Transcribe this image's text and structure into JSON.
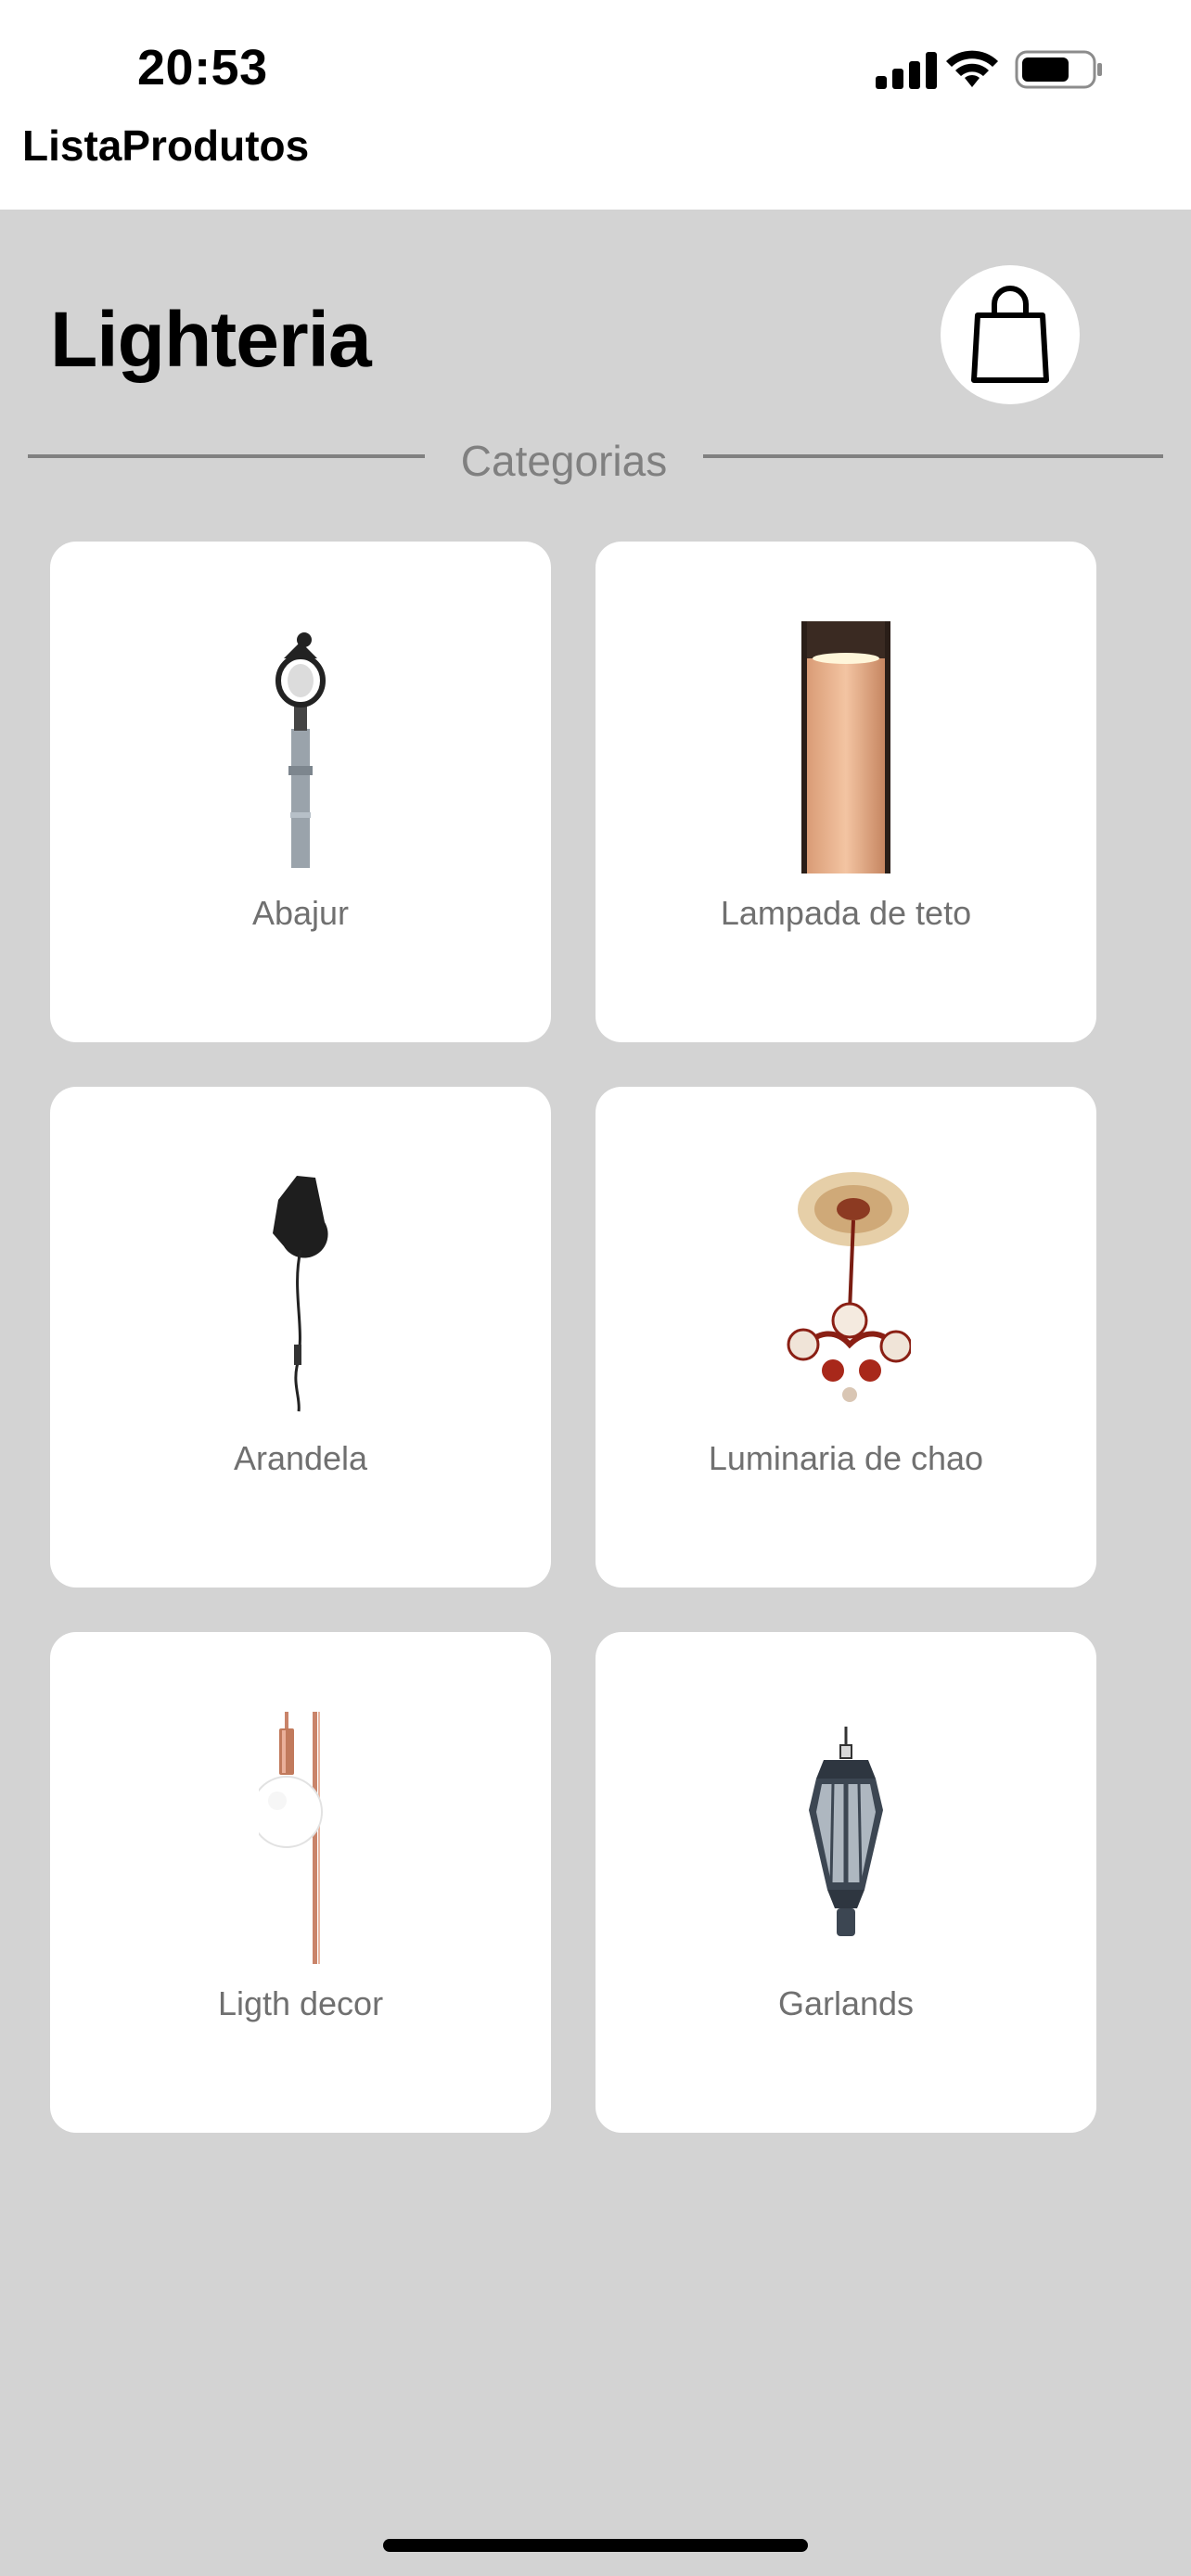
{
  "status_bar": {
    "time": "20:53",
    "icons": [
      "cellular-signal-icon",
      "wifi-icon",
      "battery-icon"
    ]
  },
  "nav": {
    "title": "ListaProdutos"
  },
  "header": {
    "brand": "Lighteria",
    "cart_icon": "shopping-bag-icon"
  },
  "section": {
    "title": "Categorias"
  },
  "categories": [
    {
      "label": "Abajur",
      "icon": "street-lamp-icon"
    },
    {
      "label": "Lampada de teto",
      "icon": "ceiling-lamp-icon"
    },
    {
      "label": "Arandela",
      "icon": "wall-sconce-icon"
    },
    {
      "label": "Luminaria de chao",
      "icon": "chandelier-icon"
    },
    {
      "label": "Ligth decor",
      "icon": "bulb-decor-icon"
    },
    {
      "label": "Garlands",
      "icon": "lantern-icon"
    }
  ],
  "colors": {
    "background": "#d3d3d3",
    "card": "#ffffff",
    "label_gray": "#707070",
    "divider": "#808080"
  }
}
